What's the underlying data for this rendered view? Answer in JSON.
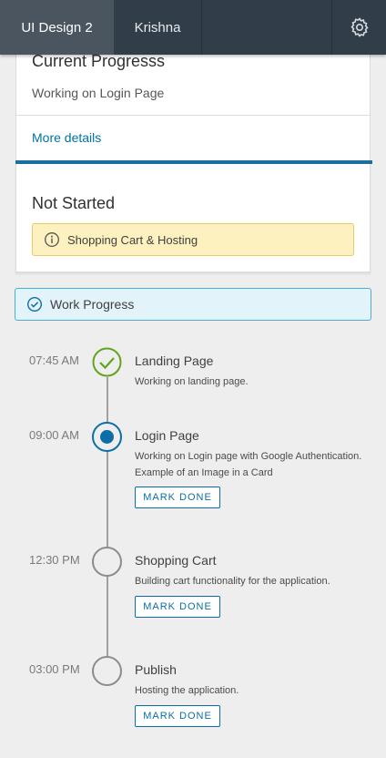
{
  "header": {
    "tabs": [
      {
        "label": "UI Design 2",
        "active": true
      },
      {
        "label": "Krishna",
        "active": false
      }
    ],
    "settings_icon": "gear-icon"
  },
  "progress_card": {
    "title": "Current Progresss",
    "subtitle": "Working on Login Page",
    "link": "More details"
  },
  "not_started_card": {
    "title": "Not Started",
    "alert_icon": "info-icon",
    "alert_text": "Shopping Cart & Hosting"
  },
  "banner": {
    "icon": "check-circle-icon",
    "text": "Work Progress"
  },
  "timeline": {
    "steps": [
      {
        "time": "07:45 AM",
        "name": "Landing Page",
        "status": "done",
        "description": "Working on landing page.",
        "button": ""
      },
      {
        "time": "09:00 AM",
        "name": "Login Page",
        "status": "current",
        "description": "Working on Login page with Google Authentication. Example of an Image in a Card",
        "button": "MARK DONE"
      },
      {
        "time": "12:30 PM",
        "name": "Shopping Cart",
        "status": "not-started",
        "description": "Building cart functionality for the application.",
        "button": "MARK DONE"
      },
      {
        "time": "03:00 PM",
        "name": "Publish",
        "status": "not-started",
        "description": "Hosting the application.",
        "button": "MARK DONE"
      }
    ]
  },
  "colors": {
    "header_bg": "#313d48",
    "accent_blue": "#0b6ea6",
    "success_green": "#62a420",
    "warning_bg": "#fdf1bf",
    "info_bg": "#e3f3fa"
  }
}
